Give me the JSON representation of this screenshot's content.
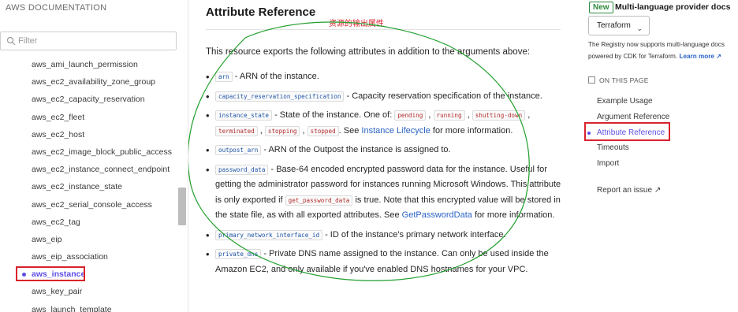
{
  "sidebar": {
    "title": "AWS DOCUMENTATION",
    "filter_placeholder": "Filter",
    "items": [
      {
        "label": "aws_ami_launch_permission"
      },
      {
        "label": "aws_ec2_availability_zone_group"
      },
      {
        "label": "aws_ec2_capacity_reservation"
      },
      {
        "label": "aws_ec2_fleet"
      },
      {
        "label": "aws_ec2_host"
      },
      {
        "label": "aws_ec2_image_block_public_access"
      },
      {
        "label": "aws_ec2_instance_connect_endpoint"
      },
      {
        "label": "aws_ec2_instance_state"
      },
      {
        "label": "aws_ec2_serial_console_access"
      },
      {
        "label": "aws_ec2_tag"
      },
      {
        "label": "aws_eip"
      },
      {
        "label": "aws_eip_association"
      },
      {
        "label": "aws_instance",
        "active": true
      },
      {
        "label": "aws_key_pair"
      },
      {
        "label": "aws_launch_template"
      }
    ]
  },
  "main": {
    "title": "Attribute Reference",
    "annotation": "资源的输出属性",
    "intro": "This resource exports the following attributes in addition to the arguments above:",
    "attributes": {
      "arn": {
        "code": "arn",
        "desc": " - ARN of the instance."
      },
      "capacity": {
        "code": "capacity_reservation_specification",
        "desc": " - Capacity reservation specification of the instance."
      },
      "instance_state": {
        "code": "instance_state",
        "desc_before": " - State of the instance. One of: ",
        "states": [
          "pending",
          "running",
          "shutting-down",
          "terminated",
          "stopping",
          "stopped"
        ],
        "desc_see": ". See ",
        "link": "Instance Lifecycle",
        "desc_after": " for more information."
      },
      "outpost_arn": {
        "code": "outpost_arn",
        "desc": " - ARN of the Outpost the instance is assigned to."
      },
      "password_data": {
        "code": "password_data",
        "desc_1": " - Base-64 encoded encrypted password data for the instance. Useful for getting the administrator password for instances running Microsoft Windows. This attribute is only exported if ",
        "code_2": "get_password_data",
        "desc_2": " is true. Note that this encrypted value will be stored in the state file, as with all exported attributes. See ",
        "link": "GetPasswordData",
        "desc_3": " for more information."
      },
      "primary_eni": {
        "code": "primary_network_interface_id",
        "desc": " - ID of the instance's primary network interface."
      },
      "private_dns": {
        "code": "private_dns",
        "desc": " - Private DNS name assigned to the instance. Can only be used inside the Amazon EC2, and only available if you've enabled DNS hostnames for your VPC."
      }
    }
  },
  "right": {
    "badge": "New",
    "heading": "Multi-language provider docs",
    "select_value": "Terraform",
    "note": "The Registry now supports multi-language docs powered by CDK for Terraform.",
    "learn_more": "Learn more ↗",
    "on_this_page": "ON THIS PAGE",
    "toc": [
      {
        "label": "Example Usage"
      },
      {
        "label": "Argument Reference"
      },
      {
        "label": "Attribute Reference",
        "active": true
      },
      {
        "label": "Timeouts"
      },
      {
        "label": "Import"
      }
    ],
    "report_issue": "Report an issue ↗"
  },
  "colors": {
    "accent": "#5c4ee5",
    "annotation_red": "#d9232d",
    "annotation_green": "#1e9e2a",
    "link_blue": "#2b63c6",
    "new_green": "#2e8b3c"
  }
}
